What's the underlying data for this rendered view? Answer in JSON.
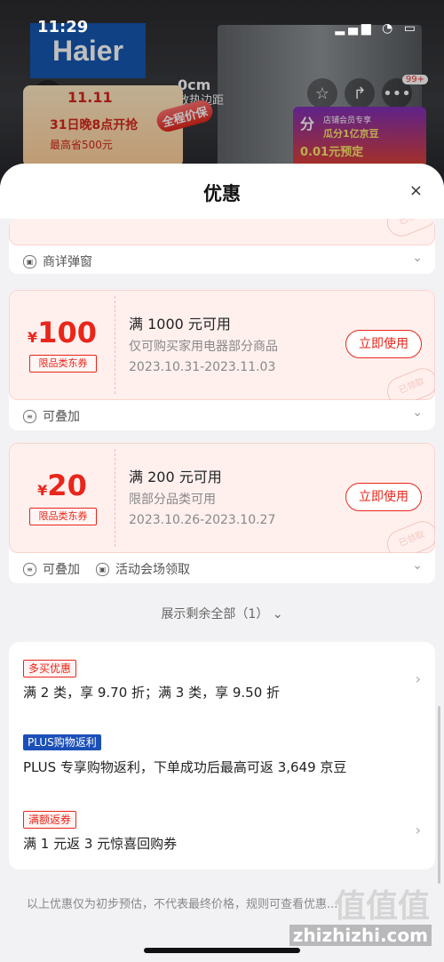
{
  "status_bar": {
    "time": "11:29",
    "signal": "▂▄▆ ◔ ▭"
  },
  "background": {
    "brand": "Haier",
    "ad_line1": "0cm",
    "ad_line2": "散热边距",
    "badge_count": "99+",
    "promo_left": {
      "logo": "11.11",
      "line1": "31日晚8点开抢",
      "line2": "最高省500元"
    },
    "promo_pill": "全程价保",
    "promo_right": {
      "big": "分",
      "line1": "店铺会员专享",
      "line2": "瓜分1亿京豆",
      "line3": "0.01元预定"
    }
  },
  "sheet": {
    "title": "优惠",
    "close_icon": "×"
  },
  "card0": {
    "footer_label": "商详弹窗"
  },
  "coupons": [
    {
      "currency": "¥",
      "amount": "100",
      "tag": "限品类东券",
      "condition": "满 1000 元可用",
      "scope": "仅可购买家用电器部分商品",
      "dates": "2023.10.31-2023.11.03",
      "button": "立即使用",
      "stamp": "已领取",
      "footer": [
        "可叠加"
      ]
    },
    {
      "currency": "¥",
      "amount": "20",
      "tag": "限品类东券",
      "condition": "满 200 元可用",
      "scope": "限部分品类可用",
      "dates": "2023.10.26-2023.10.27",
      "button": "立即使用",
      "stamp": "已领取",
      "footer": [
        "可叠加",
        "活动会场领取"
      ]
    }
  ],
  "show_more": "展示剩余全部（1）",
  "benefits": [
    {
      "tag": "多买优惠",
      "text": "满 2 类，享 9.70 折；满 3 类，享 9.50 折"
    },
    {
      "tag": "PLUS购物返利",
      "text": "PLUS 专享购物返利，下单成功后最高可返 3,649 京豆"
    },
    {
      "tag": "满额返券",
      "text": "满 1 元返 3 元惊喜回购券"
    }
  ],
  "disclaimer": "以上优惠仅为初步预估，不代表最终价格，规则可查看优惠...",
  "watermark": {
    "logo": "值值值",
    "url": "zhizhizhi.com"
  },
  "colors": {
    "accent": "#e8261a",
    "plus_blue": "#1b4fb8"
  }
}
